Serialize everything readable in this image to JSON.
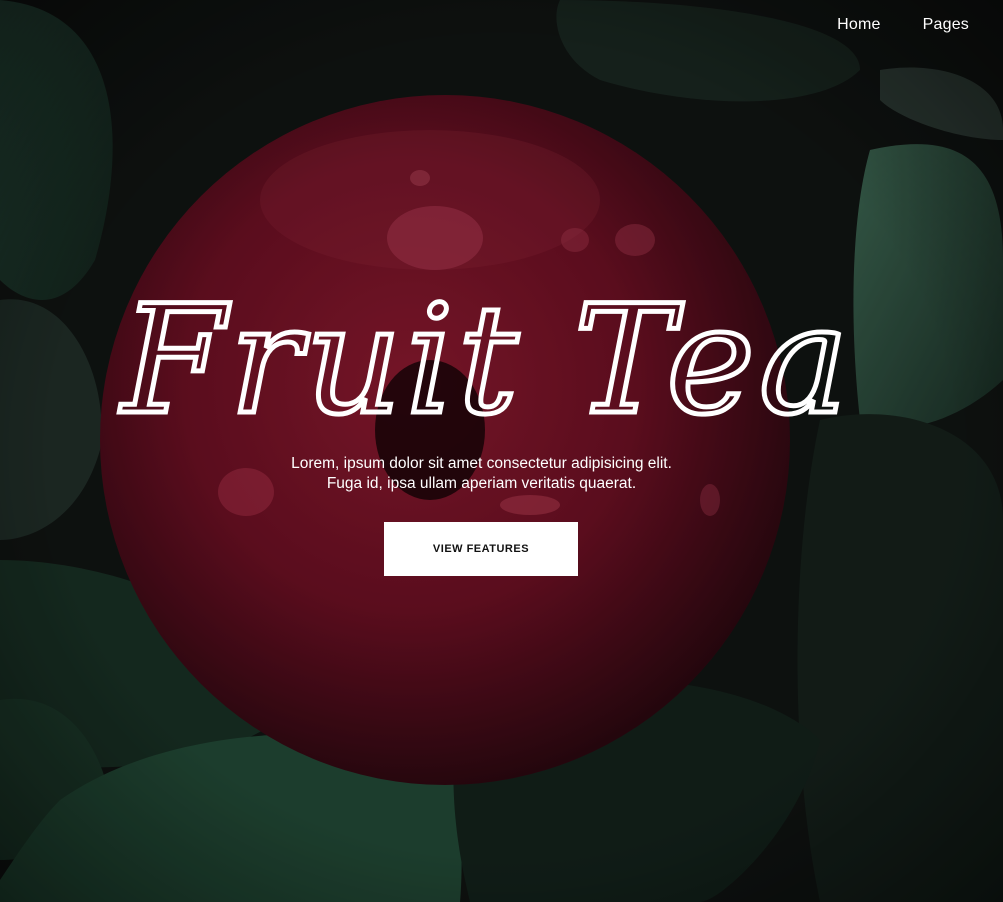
{
  "nav": {
    "items": [
      {
        "label": "Home"
      },
      {
        "label": "Pages"
      }
    ]
  },
  "hero": {
    "title": "Fruit Tea",
    "subtitle_line1": "Lorem, ipsum dolor sit amet consectetur adipisicing elit.",
    "subtitle_line2": "Fuga id, ipsa ullam aperiam veritatis quaerat.",
    "cta_label": "VIEW FEATURES"
  },
  "colors": {
    "background": "#131816",
    "fruit": "#7a1228",
    "leaf": "#1f3a2c",
    "text": "#ffffff",
    "button_bg": "#ffffff",
    "button_text": "#111111"
  }
}
